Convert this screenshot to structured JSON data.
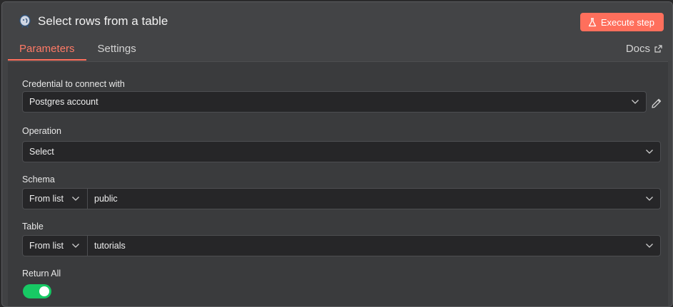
{
  "header": {
    "icon": "postgres-elephant-icon",
    "title": "Select rows from a table",
    "execute_label": "Execute step",
    "accent_color": "#ff6f5c"
  },
  "tabs": [
    {
      "label": "Parameters",
      "active": true
    },
    {
      "label": "Settings",
      "active": false
    }
  ],
  "docs_label": "Docs",
  "form": {
    "credential": {
      "label": "Credential to connect with",
      "value": "Postgres account"
    },
    "operation": {
      "label": "Operation",
      "value": "Select"
    },
    "schema": {
      "label": "Schema",
      "mode": "From list",
      "value": "public"
    },
    "table": {
      "label": "Table",
      "mode": "From list",
      "value": "tutorials"
    },
    "return_all": {
      "label": "Return All",
      "enabled": true,
      "on_color": "#17c964"
    }
  }
}
